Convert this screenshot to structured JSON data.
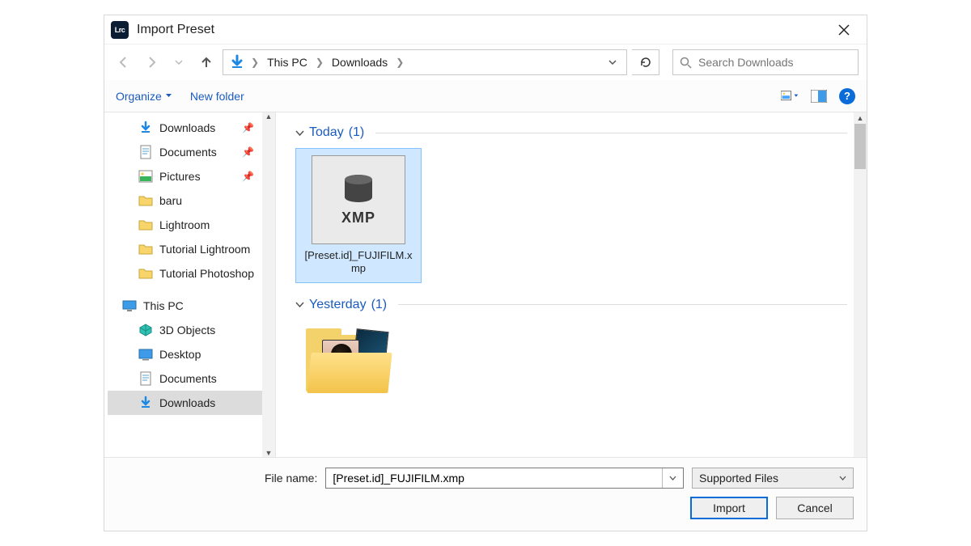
{
  "title": "Import Preset",
  "app_icon_text": "Lrc",
  "breadcrumb": {
    "segments": [
      "This PC",
      "Downloads"
    ]
  },
  "search": {
    "placeholder": "Search Downloads"
  },
  "toolbar": {
    "organize": "Organize",
    "new_folder": "New folder"
  },
  "sidebar": {
    "items": [
      {
        "label": "Downloads",
        "icon": "download",
        "pinned": true,
        "indent": 2,
        "selected": false
      },
      {
        "label": "Documents",
        "icon": "document",
        "pinned": true,
        "indent": 2,
        "selected": false
      },
      {
        "label": "Pictures",
        "icon": "pictures",
        "pinned": true,
        "indent": 2,
        "selected": false
      },
      {
        "label": "baru",
        "icon": "folder",
        "pinned": false,
        "indent": 2,
        "selected": false
      },
      {
        "label": "Lightroom",
        "icon": "folder",
        "pinned": false,
        "indent": 2,
        "selected": false
      },
      {
        "label": "Tutorial Lightroom",
        "icon": "folder",
        "pinned": false,
        "indent": 2,
        "selected": false
      },
      {
        "label": "Tutorial Photoshop",
        "icon": "folder",
        "pinned": false,
        "indent": 2,
        "selected": false
      },
      {
        "label": "This PC",
        "icon": "thispc",
        "pinned": false,
        "indent": 0,
        "selected": false
      },
      {
        "label": "3D Objects",
        "icon": "3d",
        "pinned": false,
        "indent": 2,
        "selected": false
      },
      {
        "label": "Desktop",
        "icon": "desktop",
        "pinned": false,
        "indent": 2,
        "selected": false
      },
      {
        "label": "Documents",
        "icon": "document",
        "pinned": false,
        "indent": 2,
        "selected": false
      },
      {
        "label": "Downloads",
        "icon": "download",
        "pinned": false,
        "indent": 2,
        "selected": true
      }
    ]
  },
  "groups": [
    {
      "label": "Today",
      "count": "(1)"
    },
    {
      "label": "Yesterday",
      "count": "(1)"
    }
  ],
  "selected_file": {
    "name": "[Preset.id]_FUJIFILM.xmp",
    "type_label": "XMP"
  },
  "footer": {
    "filename_label": "File name:",
    "filename_value": "[Preset.id]_FUJIFILM.xmp",
    "type_filter": "Supported Files",
    "import": "Import",
    "cancel": "Cancel"
  }
}
